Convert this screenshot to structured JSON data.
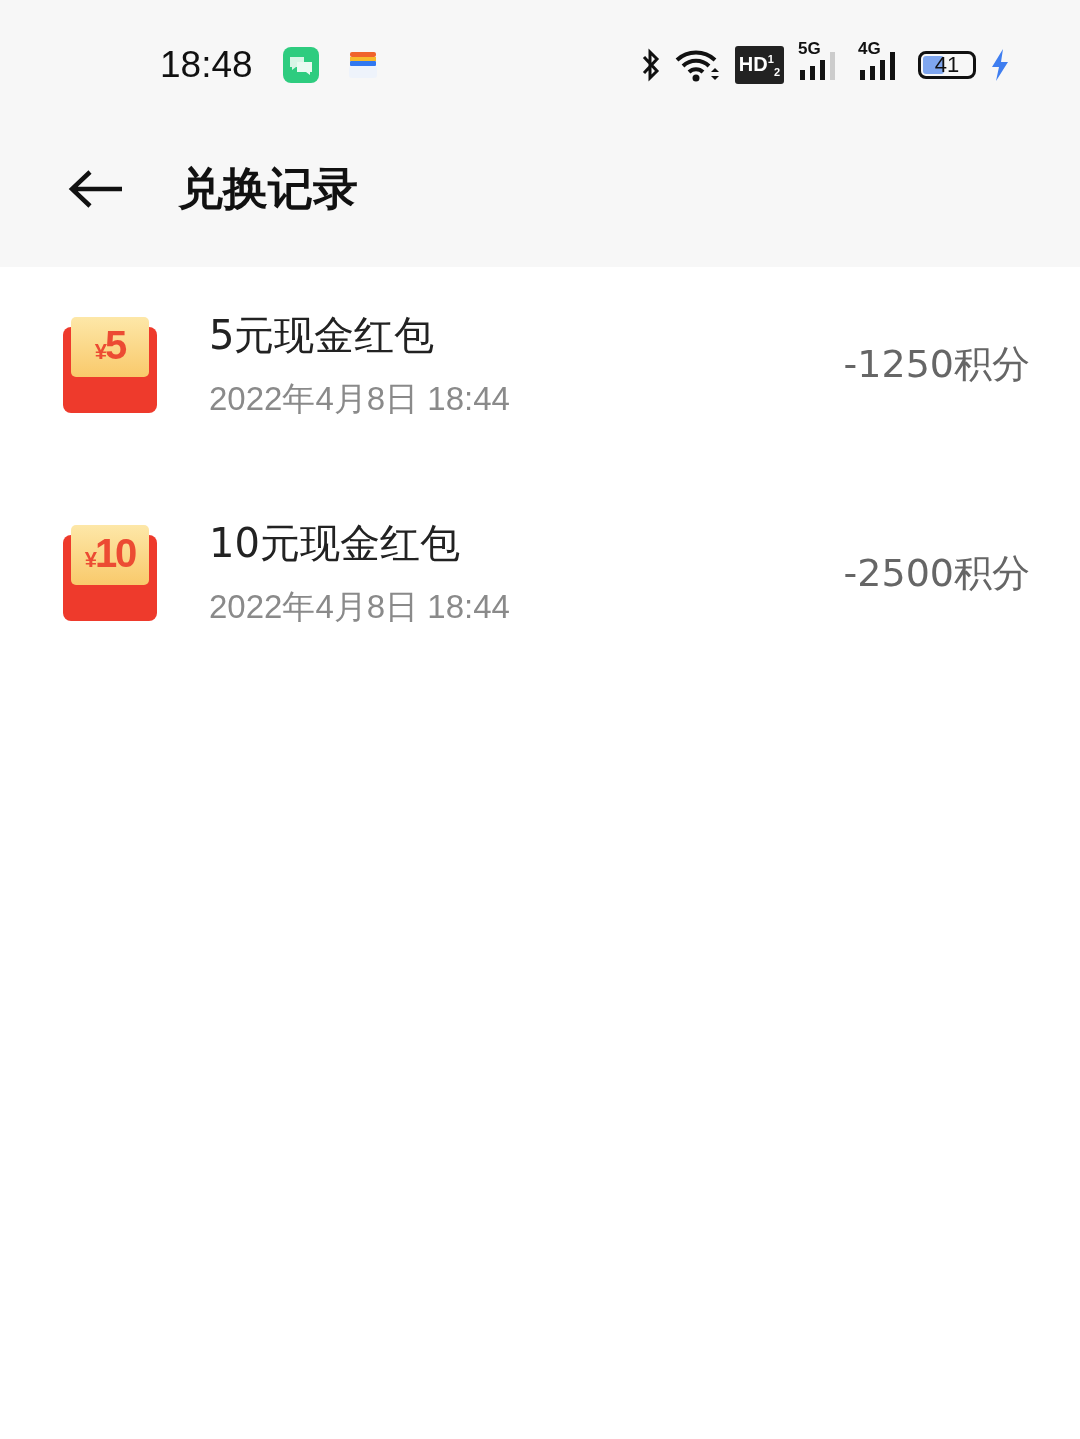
{
  "status_bar": {
    "time": "18:48",
    "hd": "HD$^{1}$$_{2}$",
    "network_1": "5G",
    "network_2": "4G",
    "battery": "41",
    "charging": true
  },
  "header": {
    "title": "兑换记录"
  },
  "records": [
    {
      "badge_currency": "¥",
      "badge_amount": "5",
      "title": "5元现金红包",
      "date": "2022年4月8日 18:44",
      "points": "-1250积分"
    },
    {
      "badge_currency": "¥",
      "badge_amount": "10",
      "title": "10元现金红包",
      "date": "2022年4月8日 18:44",
      "points": "-2500积分"
    }
  ]
}
